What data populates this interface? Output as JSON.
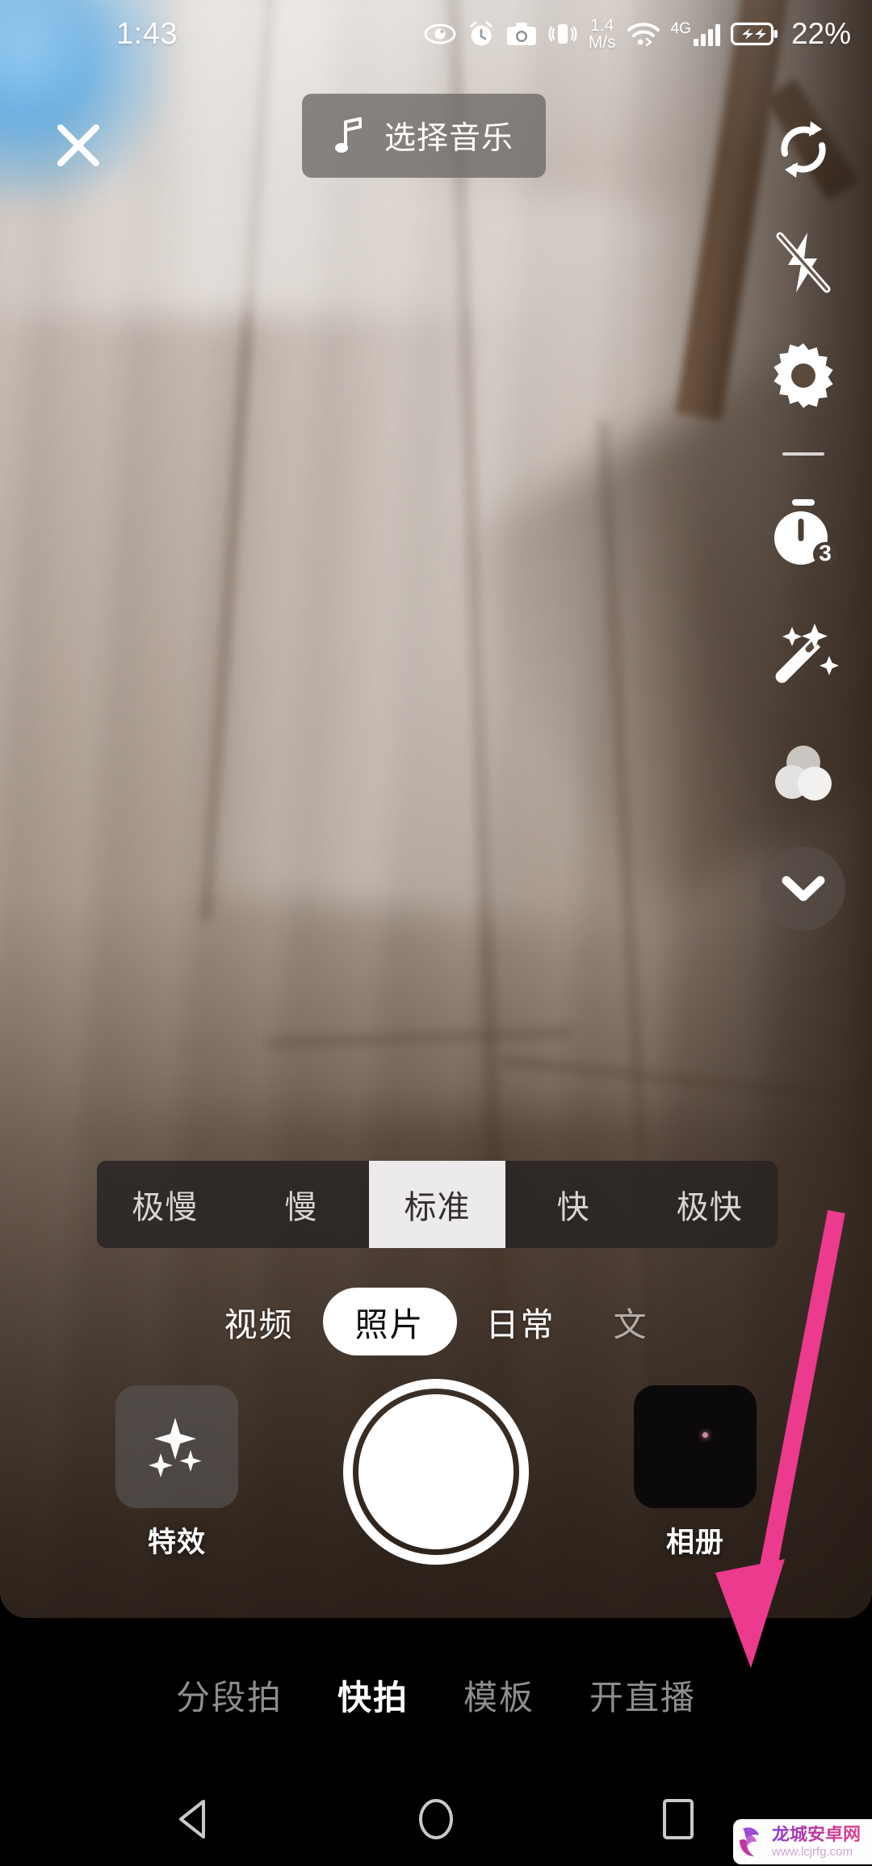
{
  "status_bar": {
    "time": "1:43",
    "net_speed_value": "1.4",
    "net_speed_unit": "M/s",
    "network_type": "4G",
    "battery_percent": "22%",
    "icons": [
      "eye-care-icon",
      "alarm-off-icon",
      "camera-icon",
      "vibrate-icon",
      "wifi-icon",
      "signal-bars-icon",
      "battery-charging-icon"
    ]
  },
  "top_bar": {
    "close_label": "×",
    "music_button_label": "选择音乐",
    "music_icon": "music-note-icon"
  },
  "right_rail": {
    "items": [
      {
        "name": "flip-camera-icon",
        "label": "翻转"
      },
      {
        "name": "flash-off-icon",
        "label": "闪光灯"
      },
      {
        "name": "settings-gear-icon",
        "label": "设置"
      },
      {
        "name": "timer-icon",
        "label": "倒计时",
        "badge": "3"
      },
      {
        "name": "beauty-wand-icon",
        "label": "美化"
      },
      {
        "name": "filter-icon",
        "label": "滤镜"
      },
      {
        "name": "chevron-down-icon",
        "label": "收起"
      }
    ]
  },
  "speed_bar": {
    "options": [
      "极慢",
      "慢",
      "标准",
      "快",
      "极快"
    ],
    "selected": "标准"
  },
  "mode_tabs": {
    "items": [
      "视频",
      "照片",
      "日常",
      "文"
    ],
    "selected": "照片"
  },
  "capture_row": {
    "effects_label": "特效",
    "effects_icon": "sparkles-icon",
    "shutter_label": "拍照",
    "album_label": "相册"
  },
  "bottom_nav": {
    "items": [
      "分段拍",
      "快拍",
      "模板",
      "开直播"
    ],
    "selected": "快拍"
  },
  "system_nav": {
    "back": "back-triangle-icon",
    "home": "home-circle-icon",
    "recents": "recents-square-icon"
  },
  "watermark": {
    "brand_cn": "龙城安卓网",
    "url": "www.lcjrfg.com",
    "logo": "hand-logo-icon"
  },
  "annotation": {
    "arrow_color": "#ec3a8e",
    "points_to": "开直播"
  }
}
